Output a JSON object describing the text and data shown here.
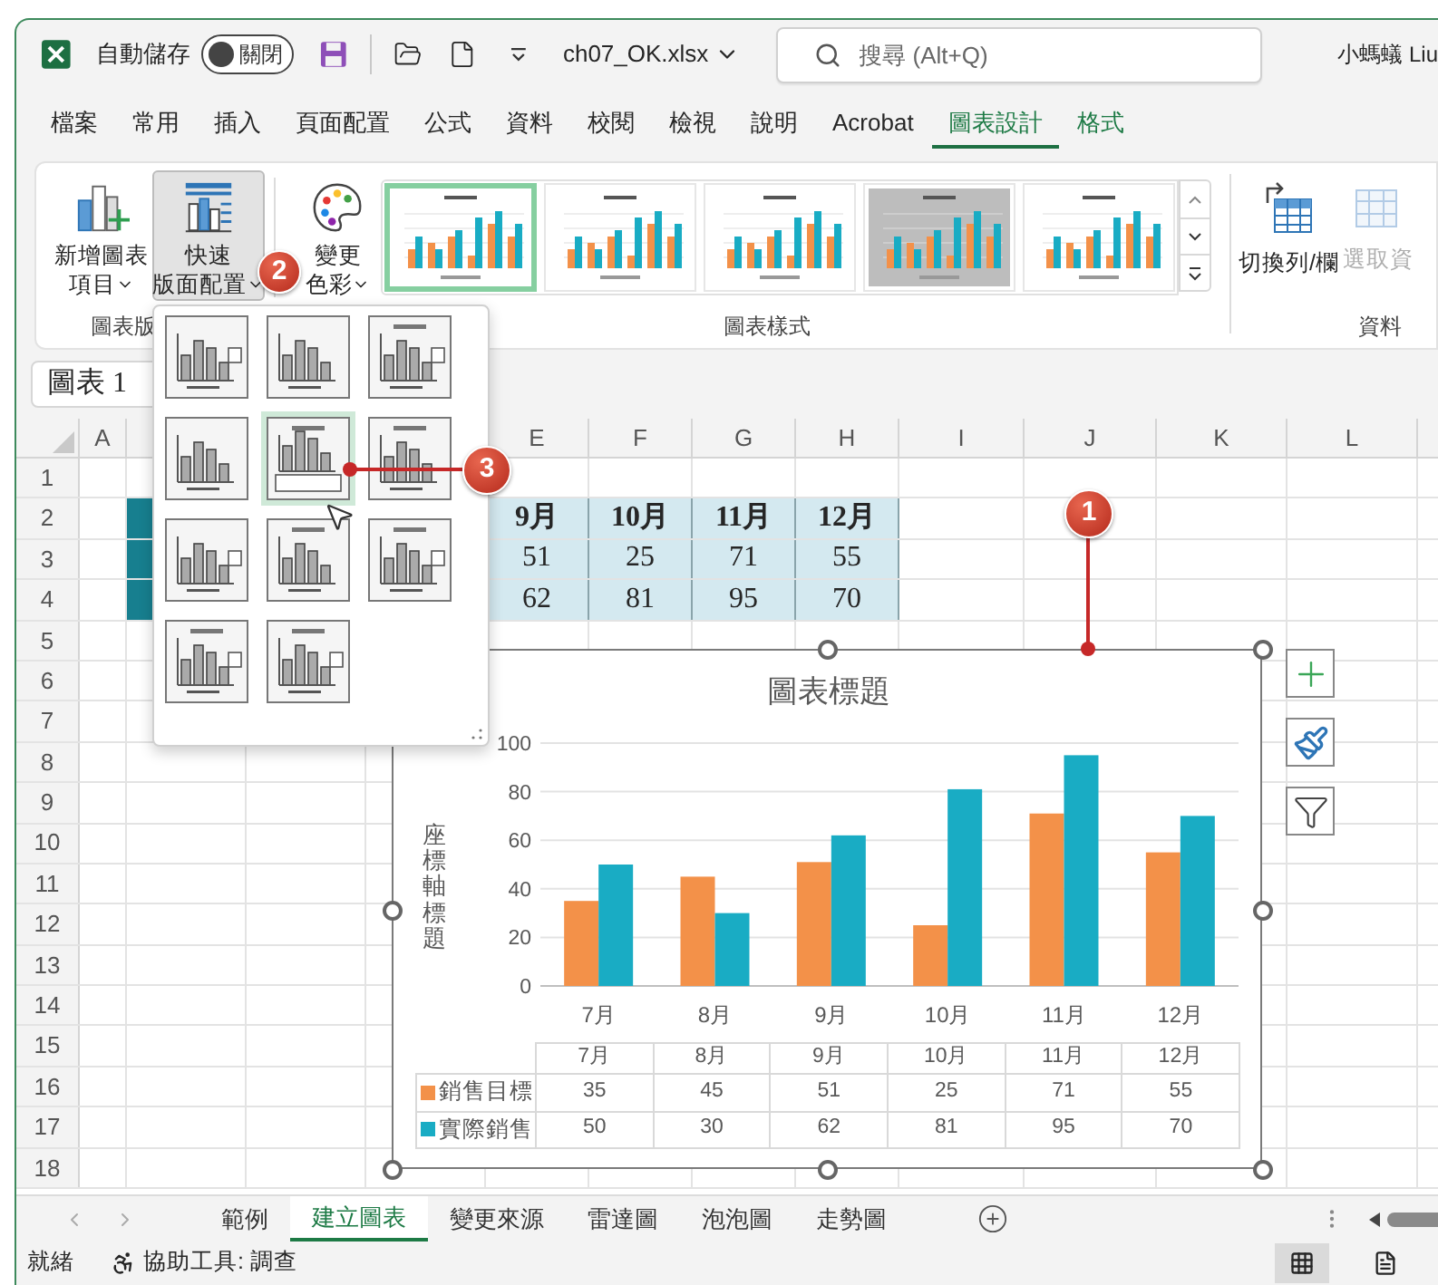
{
  "title_bar": {
    "autosave_label": "自動儲存",
    "autosave_toggle": {
      "label": "關閉",
      "on": false
    },
    "filename": "ch07_OK.xlsx",
    "search": {
      "placeholder": "搜尋 (Alt+Q)"
    },
    "user": "小螞蟻 Liu"
  },
  "menu_tabs": [
    {
      "label": "檔案",
      "kind": "normal",
      "selected": false
    },
    {
      "label": "常用",
      "kind": "normal",
      "selected": false
    },
    {
      "label": "插入",
      "kind": "normal",
      "selected": false
    },
    {
      "label": "頁面配置",
      "kind": "normal",
      "selected": false
    },
    {
      "label": "公式",
      "kind": "normal",
      "selected": false
    },
    {
      "label": "資料",
      "kind": "normal",
      "selected": false
    },
    {
      "label": "校閱",
      "kind": "normal",
      "selected": false
    },
    {
      "label": "檢視",
      "kind": "normal",
      "selected": false
    },
    {
      "label": "說明",
      "kind": "normal",
      "selected": false
    },
    {
      "label": "Acrobat",
      "kind": "normal",
      "selected": false
    },
    {
      "label": "圖表設計",
      "kind": "contextual",
      "selected": true
    },
    {
      "label": "格式",
      "kind": "contextual",
      "selected": false
    }
  ],
  "ribbon": {
    "layout_group": {
      "label": "圖表版",
      "buttons": [
        {
          "kind": "add-element",
          "line1": "新增圖表",
          "line2": "項目",
          "pressed": false
        },
        {
          "kind": "quick-layout",
          "line1": "快速",
          "line2": "版面配置",
          "pressed": true
        },
        {
          "kind": "colors",
          "line1": "變更",
          "line2": "色彩",
          "pressed": false
        }
      ]
    },
    "styles_group": {
      "label": "圖表樣式",
      "styles": [
        {
          "selected": true
        },
        {
          "selected": false
        },
        {
          "selected": false
        },
        {
          "selected": false
        },
        {
          "selected": false
        }
      ]
    },
    "data_group": {
      "label": "資料",
      "buttons": [
        {
          "kind": "switch",
          "label": "切換列/欄",
          "disabled": false
        },
        {
          "kind": "select-data",
          "label": "選取資",
          "disabled": true
        }
      ]
    }
  },
  "name_box": "圖表 1",
  "columns": [
    "A",
    "E",
    "F",
    "G",
    "H",
    "I",
    "J",
    "K",
    "L"
  ],
  "rows": [
    "1",
    "2",
    "3",
    "4",
    "5",
    "6",
    "7",
    "8",
    "9",
    "10",
    "11",
    "12",
    "13",
    "14",
    "15",
    "16",
    "17",
    "18"
  ],
  "table": {
    "header": [
      "9月",
      "10月",
      "11月",
      "12月"
    ],
    "rows": [
      [
        "51",
        "25",
        "71",
        "55"
      ],
      [
        "62",
        "81",
        "95",
        "70"
      ]
    ]
  },
  "chart": {
    "title": "圖表標題",
    "y_axis_title": "座標軸標題",
    "chart_data": {
      "type": "bar",
      "categories": [
        "7月",
        "8月",
        "9月",
        "10月",
        "11月",
        "12月"
      ],
      "series": [
        {
          "name": "銷售目標",
          "color": "#f39149",
          "values": [
            35,
            45,
            51,
            25,
            71,
            55
          ]
        },
        {
          "name": "實際銷售",
          "color": "#19acc4",
          "values": [
            50,
            30,
            62,
            81,
            95,
            70
          ]
        }
      ],
      "ylim": [
        0,
        100
      ],
      "grid": true,
      "yticks": [
        0,
        20,
        40,
        60,
        80,
        100
      ]
    },
    "data_table": {
      "header": [
        "7月",
        "8月",
        "9月",
        "10月",
        "11月",
        "12月"
      ],
      "rows": [
        {
          "values": [
            "35",
            "45",
            "51",
            "25",
            "71",
            "55"
          ]
        },
        {
          "values": [
            "50",
            "30",
            "62",
            "81",
            "95",
            "70"
          ]
        }
      ]
    }
  },
  "chart_buttons": [
    {
      "kind": "add"
    },
    {
      "kind": "style"
    },
    {
      "kind": "filter"
    }
  ],
  "layout_gallery": [
    {
      "selected": false
    },
    {
      "selected": false
    },
    {
      "selected": false
    },
    {
      "selected": false
    },
    {
      "selected": true
    },
    {
      "selected": false
    },
    {
      "selected": false
    },
    {
      "selected": false
    },
    {
      "selected": false
    },
    {
      "selected": false
    },
    {
      "selected": false
    }
  ],
  "callouts": [
    {
      "text": "1"
    },
    {
      "text": "2"
    },
    {
      "text": "3"
    }
  ],
  "sheet_tabs": [
    {
      "label": "範例",
      "selected": false
    },
    {
      "label": "建立圖表",
      "selected": true
    },
    {
      "label": "變更來源",
      "selected": false
    },
    {
      "label": "雷達圖",
      "selected": false
    },
    {
      "label": "泡泡圖",
      "selected": false
    },
    {
      "label": "走勢圖",
      "selected": false
    }
  ],
  "status_bar": {
    "status": "就緒",
    "accessibility": "協助工具: 調查",
    "views": [
      {
        "kind": "normal",
        "selected": true
      },
      {
        "kind": "page-layout",
        "selected": false
      }
    ]
  }
}
